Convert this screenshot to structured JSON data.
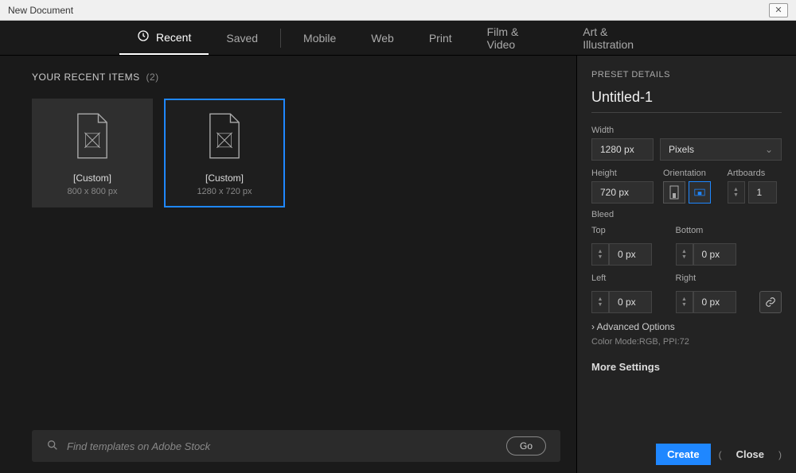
{
  "titlebar": {
    "title": "New Document"
  },
  "tabs": {
    "recent": "Recent",
    "saved": "Saved",
    "mobile": "Mobile",
    "web": "Web",
    "print": "Print",
    "film": "Film & Video",
    "art": "Art & Illustration"
  },
  "recent": {
    "heading": "YOUR RECENT ITEMS",
    "count": "(2)",
    "items": [
      {
        "title": "[Custom]",
        "sub": "800 x 800 px"
      },
      {
        "title": "[Custom]",
        "sub": "1280 x 720 px"
      }
    ]
  },
  "search": {
    "placeholder": "Find templates on Adobe Stock",
    "go": "Go"
  },
  "preset": {
    "heading": "PRESET DETAILS",
    "name": "Untitled-1",
    "width_label": "Width",
    "width_value": "1280 px",
    "unit": "Pixels",
    "height_label": "Height",
    "height_value": "720 px",
    "orientation_label": "Orientation",
    "artboards_label": "Artboards",
    "artboards_value": "1",
    "bleed_label": "Bleed",
    "top_label": "Top",
    "top_value": "0 px",
    "bottom_label": "Bottom",
    "bottom_value": "0 px",
    "left_label": "Left",
    "left_value": "0 px",
    "right_label": "Right",
    "right_value": "0 px",
    "advanced": "Advanced Options",
    "mode": "Color Mode:RGB, PPI:72",
    "more": "More Settings"
  },
  "footer": {
    "create": "Create",
    "close": "Close"
  }
}
